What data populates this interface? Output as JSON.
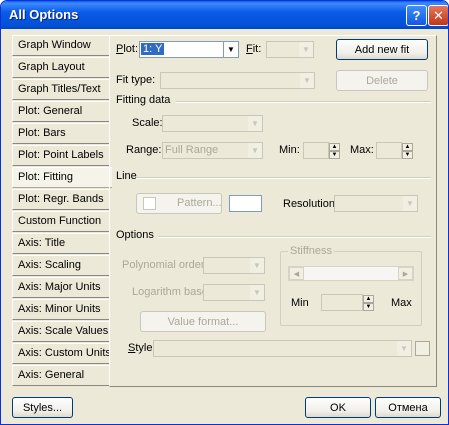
{
  "window": {
    "title": "All Options",
    "help_glyph": "?",
    "close_glyph": "✕"
  },
  "tabs": [
    "Graph Window",
    "Graph Layout",
    "Graph Titles/Text",
    "Plot: General",
    "Plot: Bars",
    "Plot: Point Labels",
    "Plot: Fitting",
    "Plot: Regr. Bands",
    "Custom Function",
    "Axis: Title",
    "Axis: Scaling",
    "Axis: Major Units",
    "Axis: Minor Units",
    "Axis: Scale Values",
    "Axis: Custom Units",
    "Axis: General"
  ],
  "active_tab": "Plot: Fitting",
  "fitting": {
    "plot_label": "lot:",
    "plot_label_u": "P",
    "plot_value": "1: Y",
    "fit_label": "it:",
    "fit_label_u": "F",
    "add_new_fit": "Add new fit",
    "fit_type_label": "Fit type:",
    "delete": "Delete",
    "fitting_data_header": "Fitting data",
    "scale_label": "Scale:",
    "range_label": "Range:",
    "range_value": "Full Range",
    "min_label": "Min:",
    "max_label": "Max:",
    "line_header": "Line",
    "pattern_button": "Pattern...",
    "resolution_label": "Resolution:",
    "options_header": "Options",
    "polynomial_order_label": "Polynomial order:",
    "logarithm_base_label": "Logarithm base:",
    "value_format_button": "Value format...",
    "stiffness_label": "Stiffness",
    "stiff_min": "Min",
    "stiff_max": "Max",
    "style_label": "tyle:",
    "style_label_u": "S"
  },
  "footer": {
    "styles": "Styles...",
    "ok": "OK",
    "cancel": "Отмена"
  }
}
